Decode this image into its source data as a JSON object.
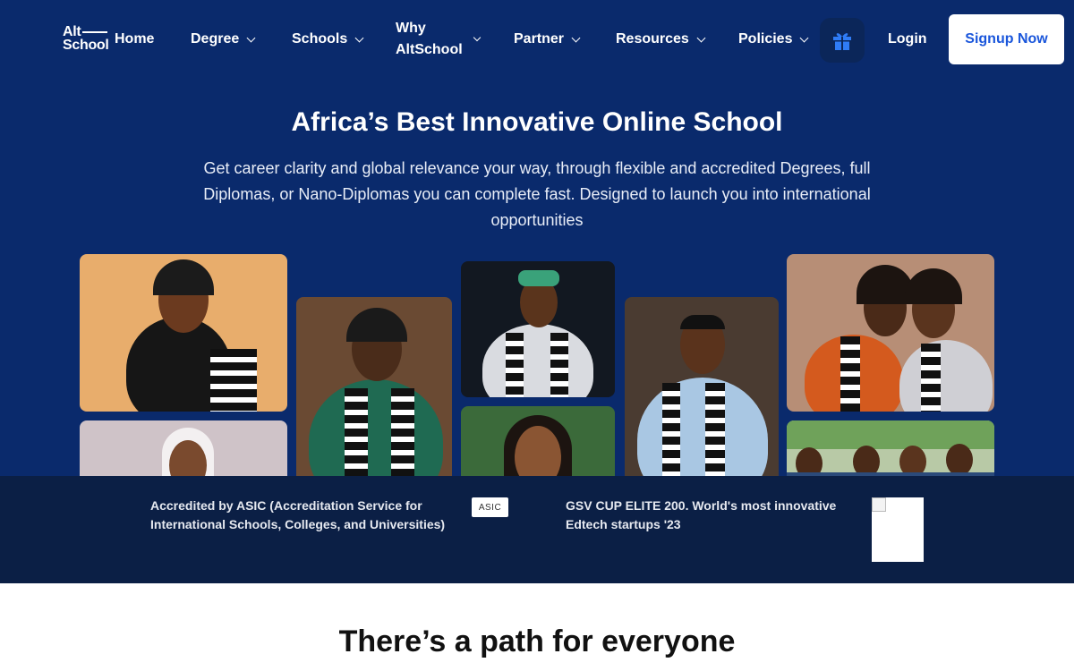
{
  "nav": {
    "logo_line1": "Alt",
    "logo_line2": "School",
    "items": [
      {
        "label": "Home",
        "has_dropdown": false
      },
      {
        "label": "Degree",
        "has_dropdown": true
      },
      {
        "label": "Schools",
        "has_dropdown": true
      },
      {
        "label_line1": "Why",
        "label_line2": "AltSchool",
        "has_dropdown": true
      },
      {
        "label": "Partner",
        "has_dropdown": true
      },
      {
        "label": "Resources",
        "has_dropdown": true
      },
      {
        "label": "Policies",
        "has_dropdown": true
      }
    ],
    "gift_icon": "gift-icon",
    "login_label": "Login",
    "signup_label": "Signup Now"
  },
  "hero": {
    "title": "Africa’s Best Innovative Online School",
    "subtitle": "Get career clarity and global relevance your way, through flexible and accredited Degrees, full Diplomas, or Nano-Diplomas you can complete fast. Designed to launch you into international opportunities"
  },
  "accreditation": {
    "asic_text": "Accredited by ASIC (Accreditation Service for International Schools, Colleges, and Universities)",
    "asic_logo": "ASIC",
    "gsv_text": "GSV CUP ELITE 200. World's most innovative Edtech startups '23"
  },
  "section": {
    "path_title": "There’s a path for everyone"
  },
  "colors": {
    "hero_bg": "#0a2a6c",
    "band_bg": "#0b1f45",
    "accent": "#1a56db"
  }
}
